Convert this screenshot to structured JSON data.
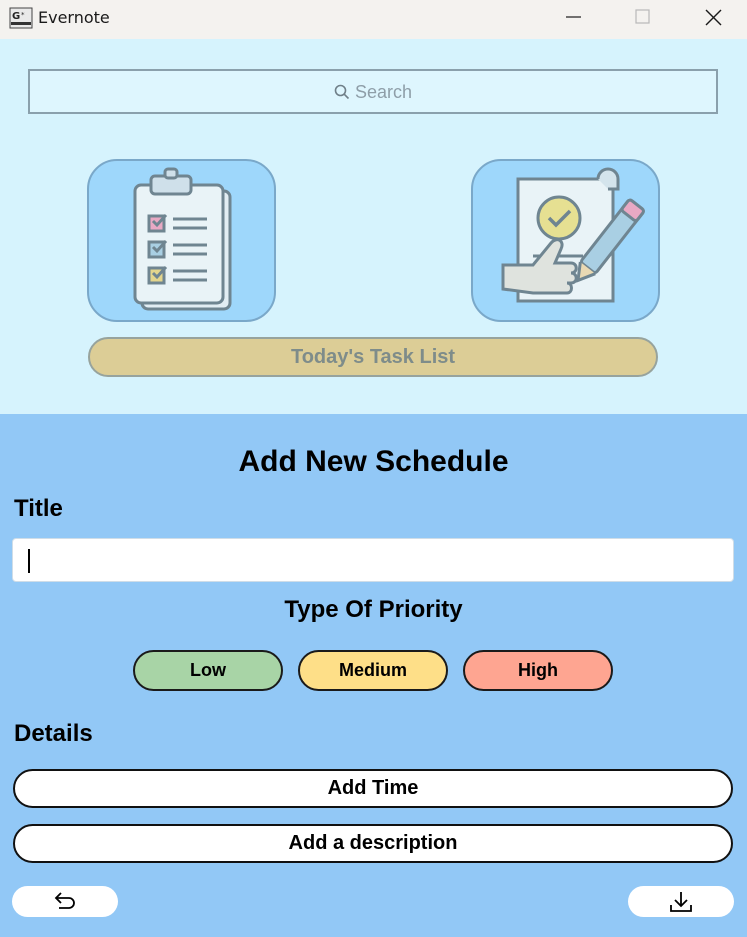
{
  "window": {
    "title": "Evernote",
    "icons": {
      "logo": "evernote-logo",
      "minimize": "minimize-icon",
      "maximize": "maximize-icon",
      "close": "close-icon"
    }
  },
  "search": {
    "placeholder": "Search",
    "icon": "search-icon"
  },
  "cards": [
    {
      "name": "clipboard-checklist-card",
      "icon": "clipboard-checklist-icon"
    },
    {
      "name": "approved-document-card",
      "icon": "approved-document-icon"
    }
  ],
  "task_list_button": {
    "label": "Today's Task List"
  },
  "form": {
    "heading": "Add New Schedule",
    "title_label": "Title",
    "title_value": "",
    "priority_heading": "Type Of Priority",
    "priorities": [
      {
        "label": "Low",
        "color": "#a8d4a6"
      },
      {
        "label": "Medium",
        "color": "#fedf88"
      },
      {
        "label": "High",
        "color": "#fea591"
      }
    ],
    "details_label": "Details",
    "add_time_label": "Add Time",
    "add_description_label": "Add a description"
  },
  "footer": {
    "back_icon": "back-arrow-icon",
    "save_icon": "download-icon"
  },
  "colors": {
    "upper_bg": "#d6f3fd",
    "lower_bg": "#92c8f6",
    "card_bg": "#9ed7fb",
    "task_bar": "#dccd96"
  }
}
